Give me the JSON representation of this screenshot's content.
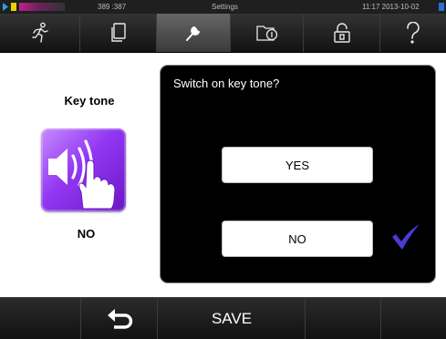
{
  "status_bar": {
    "counter_text": "389 :387",
    "title": "Settings",
    "datetime": "11:17  2013-10-02",
    "indicator_colors": [
      "#2aa0e0",
      "#e6d200",
      "#c0208c",
      "#2f6fd8"
    ]
  },
  "nav": {
    "tabs": [
      {
        "name": "tab-program",
        "icon": "running-man-icon"
      },
      {
        "name": "tab-documents",
        "icon": "document-icon"
      },
      {
        "name": "tab-settings",
        "icon": "wrench-icon",
        "active": true
      },
      {
        "name": "tab-info",
        "icon": "info-folder-icon"
      },
      {
        "name": "tab-lock",
        "icon": "lock-icon"
      },
      {
        "name": "tab-help",
        "icon": "question-mark-icon"
      }
    ]
  },
  "setting": {
    "title": "Key tone",
    "icon": "speaker-touch-icon",
    "current_value": "NO"
  },
  "dialog": {
    "question": "Switch on key tone?",
    "yes_label": "YES",
    "no_label": "NO",
    "selected": "NO",
    "check_icon": "checkmark-icon"
  },
  "bottom_bar": {
    "back_icon": "back-arrow-icon",
    "save_label": "SAVE"
  },
  "colors": {
    "accent_purple": "#7b2fd6",
    "check_blue": "#4a3bd8",
    "dialog_bg": "#000000",
    "bar_bg": "#1a1a1a"
  }
}
